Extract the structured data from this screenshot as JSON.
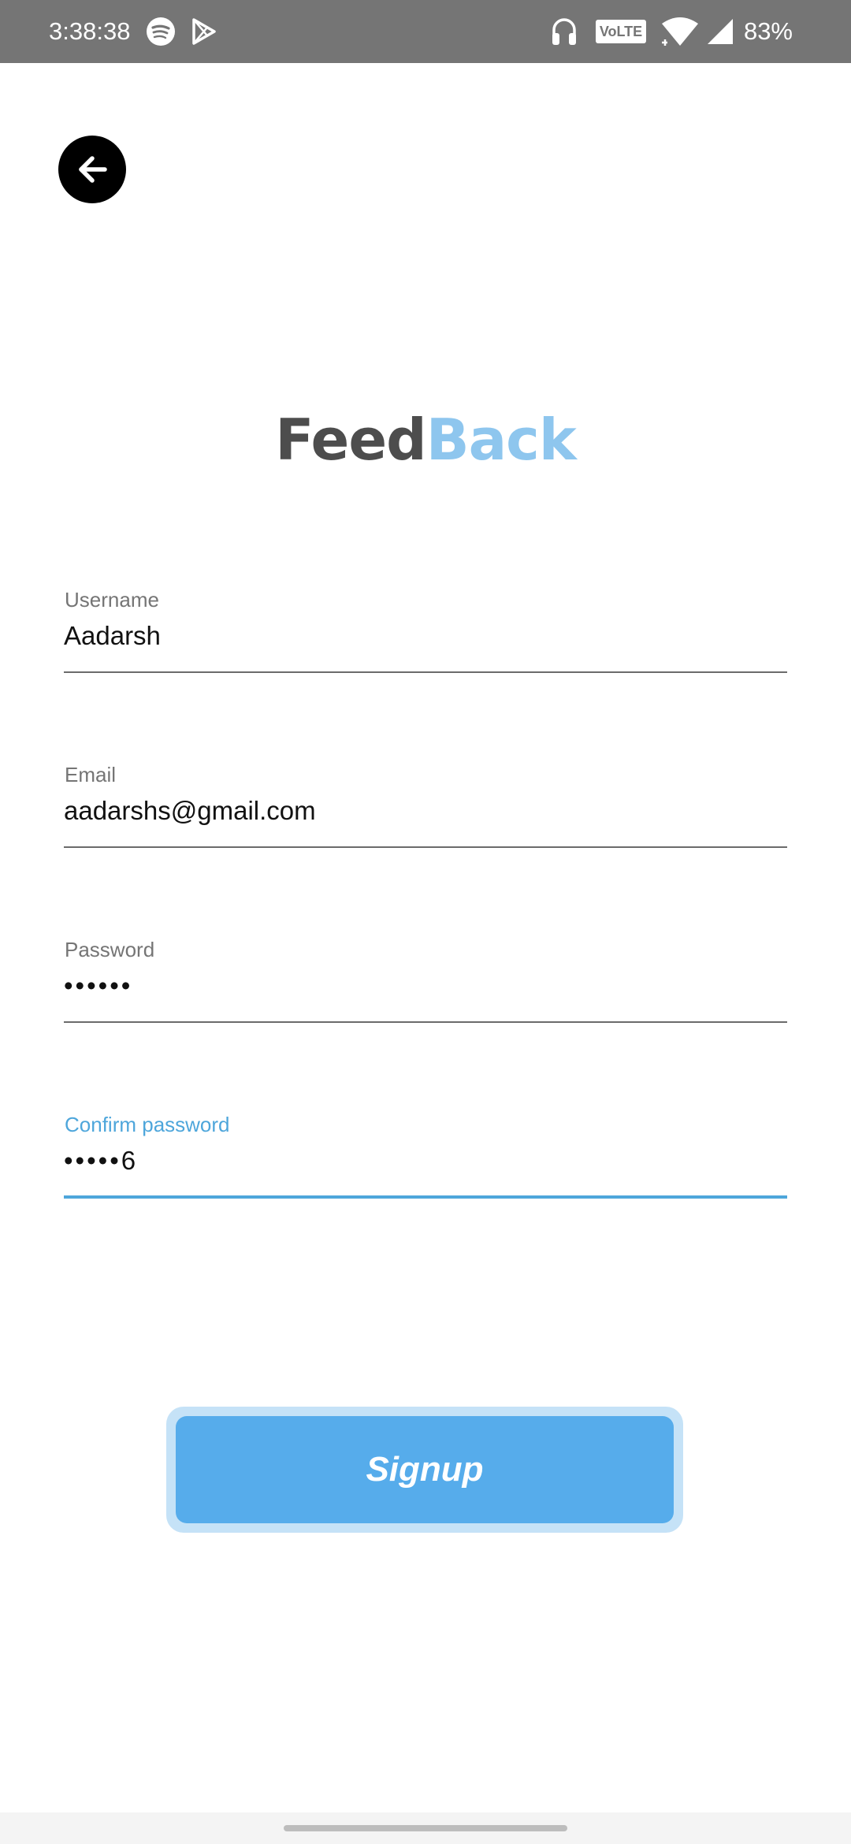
{
  "status_bar": {
    "time": "3:38:38",
    "volte": "VoLTE",
    "battery": "83%",
    "icons": [
      "spotify-icon",
      "play-store-icon",
      "headphones-icon",
      "volte-icon",
      "wifi-icon",
      "signal-icon"
    ]
  },
  "header": {
    "back_icon": "arrow-left-icon"
  },
  "logo": {
    "part1": "Feed",
    "part2": "Back",
    "colors": {
      "part1": "#4d4d4d",
      "part2": "#8ec6ee"
    }
  },
  "form": {
    "username": {
      "label": "Username",
      "value": "Aadarsh"
    },
    "email": {
      "label": "Email",
      "value": "aadarshs@gmail.com"
    },
    "password": {
      "label": "Password",
      "value": "••••••"
    },
    "confirm_password": {
      "label": "Confirm password",
      "value": "•••••6",
      "focused": true
    }
  },
  "signup_button": {
    "label": "Signup"
  },
  "colors": {
    "accent": "#56aceb",
    "accent_light": "#c5e2f7",
    "focus": "#4ea6db",
    "status_bar": "#757575"
  }
}
